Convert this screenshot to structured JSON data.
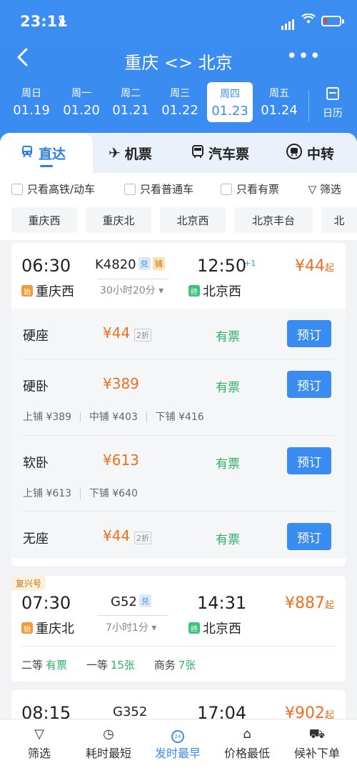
{
  "status": {
    "time": "23:11"
  },
  "nav": {
    "title": "重庆 <> 北京"
  },
  "dates": [
    {
      "weekday": "周日",
      "date": "01.19"
    },
    {
      "weekday": "周一",
      "date": "01.20"
    },
    {
      "weekday": "周二",
      "date": "01.21"
    },
    {
      "weekday": "周三",
      "date": "01.22"
    },
    {
      "weekday": "周四",
      "date": "01.23",
      "selected": true
    },
    {
      "weekday": "周五",
      "date": "01.24"
    }
  ],
  "calendar_label": "日历",
  "modes": [
    {
      "label": "直达",
      "icon": "train-icon",
      "active": true
    },
    {
      "label": "机票",
      "icon": "plane-icon"
    },
    {
      "label": "汽车票",
      "icon": "bus-icon"
    },
    {
      "label": "中转",
      "icon": "transfer-icon"
    }
  ],
  "filters": [
    {
      "label": "只看高铁/动车"
    },
    {
      "label": "只看普通车"
    },
    {
      "label": "只看有票"
    }
  ],
  "filter_button": "筛选",
  "stations": [
    "重庆西",
    "重庆北",
    "北京西",
    "北京丰台",
    "北"
  ],
  "trains": [
    {
      "dep_time": "06:30",
      "arr_time": "12:50",
      "arr_plus": "+1",
      "train_no": "K4820",
      "badges": [
        "兑",
        "铺"
      ],
      "duration": "30小时20分",
      "from": "重庆西",
      "from_tag": "始",
      "to": "北京西",
      "to_tag": "终",
      "price": "¥44",
      "price_suffix": "起",
      "seats": [
        {
          "name": "硬座",
          "price": "¥44",
          "discount": "2折",
          "avail": "有票",
          "book": "预订"
        },
        {
          "name": "硬卧",
          "price": "¥389",
          "avail": "有票",
          "book": "预订",
          "berths": [
            "上铺 ¥389",
            "中铺 ¥403",
            "下铺 ¥416"
          ]
        },
        {
          "name": "软卧",
          "price": "¥613",
          "avail": "有票",
          "book": "预订",
          "berths": [
            "上铺 ¥613",
            "下铺 ¥640"
          ]
        },
        {
          "name": "无座",
          "price": "¥44",
          "discount": "2折",
          "avail": "有票",
          "book": "预订"
        }
      ]
    },
    {
      "label": "复兴号",
      "dep_time": "07:30",
      "arr_time": "14:31",
      "train_no": "G52",
      "badges": [
        "兑"
      ],
      "duration": "7小时1分",
      "from": "重庆北",
      "from_tag": "始",
      "to": "北京西",
      "to_tag": "终",
      "price": "¥887",
      "price_suffix": "起",
      "classes": [
        {
          "name": "二等",
          "value": "有票"
        },
        {
          "name": "一等",
          "value": "15张"
        },
        {
          "name": "商务",
          "value": "7张"
        }
      ]
    },
    {
      "dep_time": "08:15",
      "arr_time": "17:04",
      "train_no": "G352",
      "price": "¥902",
      "price_suffix": "起"
    }
  ],
  "bottom_bar": [
    {
      "label": "筛选",
      "icon": "filter-icon"
    },
    {
      "label": "耗时最短",
      "icon": "timer-icon"
    },
    {
      "label": "发时最早",
      "icon": "clock-24-icon",
      "icon_text": "24",
      "active": true
    },
    {
      "label": "价格最低",
      "icon": "price-tag-icon"
    },
    {
      "label": "候补下单",
      "icon": "cart-icon"
    }
  ],
  "colors": {
    "primary": "#3a8cf0",
    "price": "#f06f20",
    "available": "#2fb366"
  }
}
